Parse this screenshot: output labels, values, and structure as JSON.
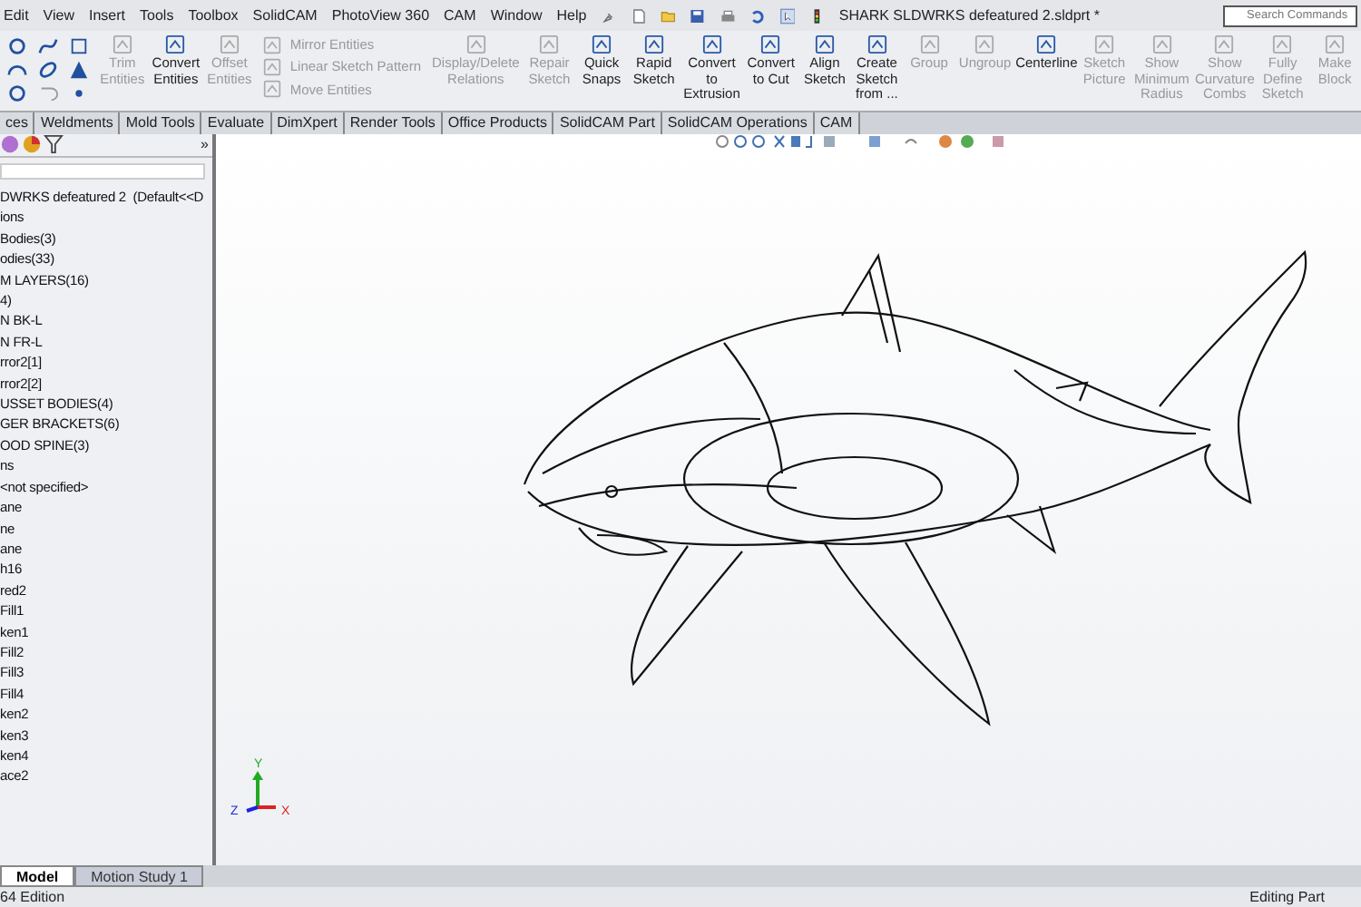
{
  "menu": [
    "Edit",
    "View",
    "Insert",
    "Tools",
    "Toolbox",
    "SolidCAM",
    "PhotoView 360",
    "CAM",
    "Window",
    "Help"
  ],
  "window": {
    "title": "SHARK SLDWRKS defeatured 2.sldprt *"
  },
  "search": {
    "placeholder": "Search Commands"
  },
  "ribbon": [
    {
      "label": "Trim Entities",
      "kind": "large",
      "disabled": true
    },
    {
      "label": "Convert Entities",
      "kind": "large",
      "disabled": false
    },
    {
      "label": "Offset Entities",
      "kind": "large",
      "disabled": true
    },
    {
      "label": "Mirror Entities",
      "kind": "small",
      "disabled": true
    },
    {
      "label": "Linear Sketch Pattern",
      "kind": "small",
      "disabled": true
    },
    {
      "label": "Move Entities",
      "kind": "small",
      "disabled": true
    },
    {
      "label": "Display/Delete Relations",
      "kind": "wide",
      "disabled": true
    },
    {
      "label": "Repair Sketch",
      "kind": "large",
      "disabled": true
    },
    {
      "label": "Quick Snaps",
      "kind": "large",
      "disabled": false
    },
    {
      "label": "Rapid Sketch",
      "kind": "large",
      "disabled": false
    },
    {
      "label": "Convert to Extrusion",
      "kind": "large",
      "disabled": false
    },
    {
      "label": "Convert to Cut",
      "kind": "large",
      "disabled": false
    },
    {
      "label": "Align Sketch",
      "kind": "large",
      "disabled": false
    },
    {
      "label": "Create Sketch from ...",
      "kind": "large",
      "disabled": false
    },
    {
      "label": "Group",
      "kind": "large",
      "disabled": true
    },
    {
      "label": "Ungroup",
      "kind": "large",
      "disabled": true
    },
    {
      "label": "Centerline",
      "kind": "large",
      "disabled": false
    },
    {
      "label": "Sketch Picture",
      "kind": "large",
      "disabled": true
    },
    {
      "label": "Show Minimum Radius",
      "kind": "large",
      "disabled": true
    },
    {
      "label": "Show Curvature Combs",
      "kind": "large",
      "disabled": true
    },
    {
      "label": "Fully Define Sketch",
      "kind": "large",
      "disabled": true
    },
    {
      "label": "Make Block",
      "kind": "large",
      "disabled": true
    }
  ],
  "tabs": [
    {
      "label": "ces",
      "selected": false
    },
    {
      "label": "Weldments",
      "selected": false
    },
    {
      "label": "Mold Tools",
      "selected": false
    },
    {
      "label": "Evaluate",
      "selected": false
    },
    {
      "label": "DimXpert",
      "selected": false
    },
    {
      "label": "Render Tools",
      "selected": false
    },
    {
      "label": "Office Products",
      "selected": false
    },
    {
      "label": "SolidCAM Part",
      "selected": false
    },
    {
      "label": "SolidCAM Operations",
      "selected": false
    },
    {
      "label": "CAM",
      "selected": false
    }
  ],
  "sidebar": {
    "expand_glyph": "»",
    "items": [
      {
        "label": "DWRKS defeatured 2  (Default<<D"
      },
      {
        "label": "ions"
      },
      {
        "label": "Bodies(3)"
      },
      {
        "label": "odies(33)"
      },
      {
        "label": "M LAYERS(16)"
      },
      {
        "label": "4)"
      },
      {
        "label": "N BK-L"
      },
      {
        "label": "N FR-L"
      },
      {
        "label": "rror2[1]"
      },
      {
        "label": "rror2[2]"
      },
      {
        "label": "USSET BODIES(4)"
      },
      {
        "label": "GER BRACKETS(6)"
      },
      {
        "label": "OOD SPINE(3)"
      },
      {
        "label": "ns"
      },
      {
        "label": "<not specified>"
      },
      {
        "label": "ane"
      },
      {
        "label": "ne"
      },
      {
        "label": "ane"
      },
      {
        "label": "h16"
      },
      {
        "label": "red2"
      },
      {
        "label": "Fill1"
      },
      {
        "label": "ken1"
      },
      {
        "label": "Fill2"
      },
      {
        "label": "Fill3"
      },
      {
        "label": "Fill4"
      },
      {
        "label": "ken2"
      },
      {
        "label": "ken3"
      },
      {
        "label": "ken4"
      },
      {
        "label": "ace2"
      }
    ]
  },
  "triad": {
    "y": "Y",
    "x": "X",
    "z": "Z"
  },
  "bottom_tabs": [
    {
      "label": "Model",
      "selected": true
    },
    {
      "label": "Motion Study 1",
      "selected": false
    }
  ],
  "status_bar": {
    "left": "64 Edition",
    "right": "Editing Part"
  }
}
